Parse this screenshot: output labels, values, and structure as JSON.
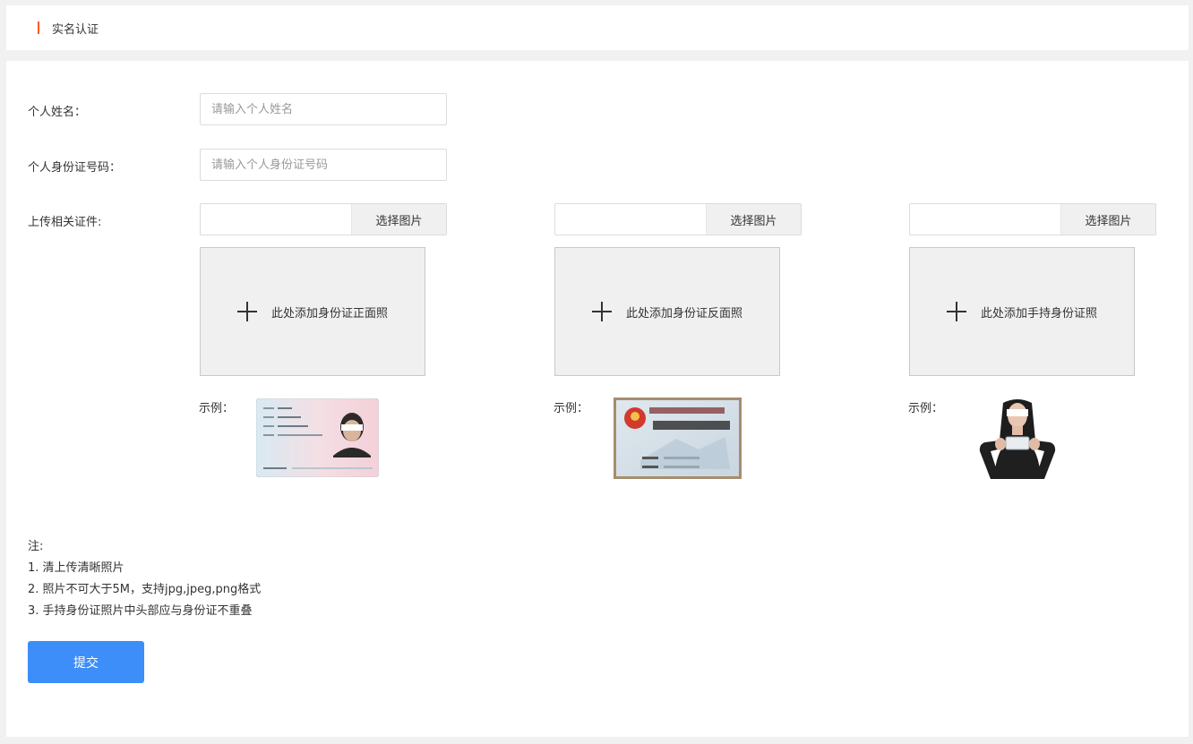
{
  "header": {
    "title": "实名认证"
  },
  "form": {
    "name_label": "个人姓名：",
    "name_placeholder": "请输入个人姓名",
    "id_label": "个人身份证号码：",
    "id_placeholder": "请输入个人身份证号码",
    "upload_label": "上传相关证件:"
  },
  "uploads": [
    {
      "button": "选择图片",
      "drop_text": "此处添加身份证正面照",
      "example_label": "示例："
    },
    {
      "button": "选择图片",
      "drop_text": "此处添加身份证反面照",
      "example_label": "示例："
    },
    {
      "button": "选择图片",
      "drop_text": "此处添加手持身份证照",
      "example_label": "示例："
    }
  ],
  "notes": {
    "title": "注:",
    "items": [
      "1. 清上传清晰照片",
      "2. 照片不可大于5M，支持jpg,jpeg,png格式",
      "3. 手持身份证照片中头部应与身份证不重叠"
    ]
  },
  "submit_label": "提交",
  "colors": {
    "accent": "#ff5a00",
    "primary": "#3d8ef8"
  }
}
